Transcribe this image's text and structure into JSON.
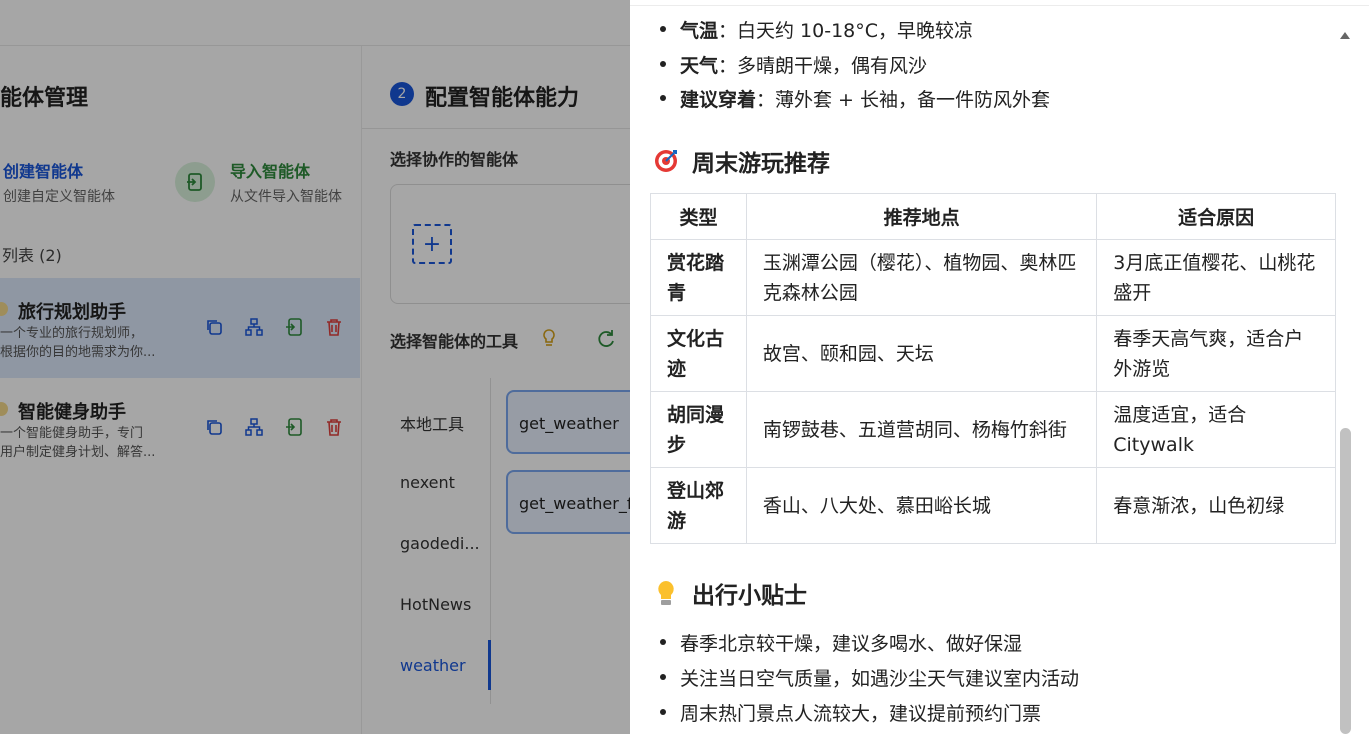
{
  "left_panel": {
    "title": "能体管理",
    "create": {
      "label": "创建智能体",
      "desc": "创建自定义智能体"
    },
    "import": {
      "label": "导入智能体",
      "desc": "从文件导入智能体"
    },
    "list_title": "列表 (2)",
    "agents": [
      {
        "name": "旅行规划助手",
        "desc_line1": "一个专业的旅行规划师，",
        "desc_line2": "根据你的目的地需求为你..."
      },
      {
        "name": "智能健身助手",
        "desc_line1": "一个智能健身助手，专门",
        "desc_line2": "用户制定健身计划、解答..."
      }
    ]
  },
  "mid_panel": {
    "step": "2",
    "title": "配置智能体能力",
    "collab_label": "选择协作的智能体",
    "add_symbol": "+",
    "tools_label": "选择智能体的工具",
    "categories": [
      "本地工具",
      "nexent",
      "gaodedi...",
      "HotNews",
      "weather"
    ],
    "tools": [
      "get_weather",
      "get_weather_fo"
    ]
  },
  "drawer": {
    "weather_items": [
      {
        "key": "气温",
        "text": "：白天约 10-18°C，早晚较凉"
      },
      {
        "key": "天气",
        "text": "：多晴朗干燥，偶有风沙"
      },
      {
        "key": "建议穿着",
        "text": "：薄外套 + 长袖，备一件防风外套"
      }
    ],
    "weekend_heading": "周末游玩推荐",
    "table": {
      "headers": [
        "类型",
        "推荐地点",
        "适合原因"
      ],
      "rows": [
        [
          "赏花踏青",
          "玉渊潭公园（樱花）、植物园、奥林匹克森林公园",
          "3月底正值樱花、山桃花盛开"
        ],
        [
          "文化古迹",
          "故宫、颐和园、天坛",
          "春季天高气爽，适合户外游览"
        ],
        [
          "胡同漫步",
          "南锣鼓巷、五道营胡同、杨梅竹斜街",
          "温度适宜，适合Citywalk"
        ],
        [
          "登山郊游",
          "香山、八大处、慕田峪长城",
          "春意渐浓，山色初绿"
        ]
      ]
    },
    "tips_heading": "出行小贴士",
    "tips": [
      "春季北京较干燥，建议多喝水、做好保湿",
      "关注当日空气质量，如遇沙尘天气建议室内活动",
      "周末热门景点人流较大，建议提前预约门票"
    ]
  },
  "colors": {
    "accent": "#1a56db",
    "success": "#2e8b3d",
    "danger": "#e0403c",
    "overlay": "rgba(0,0,0,0.35)"
  },
  "icons": [
    "import-icon",
    "copy-icon",
    "org-chart-icon",
    "export-icon",
    "trash-icon",
    "lightbulb-icon",
    "refresh-icon",
    "target-icon",
    "scroll-up-icon"
  ]
}
